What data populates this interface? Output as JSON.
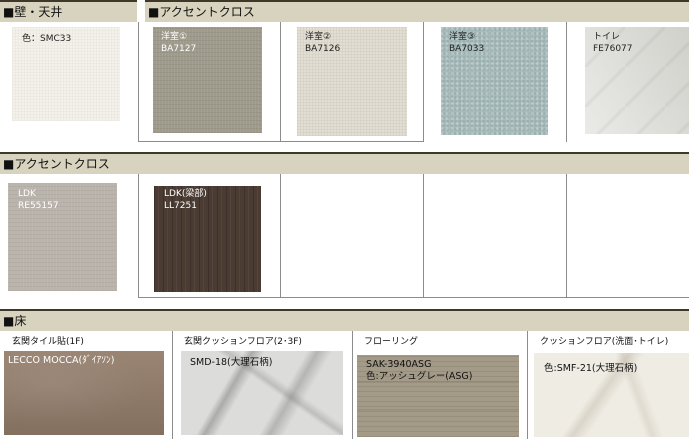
{
  "sections": {
    "wall_ceiling": "■壁・天井",
    "accent_cloth_1": "■アクセントクロス",
    "accent_cloth_2": "■アクセントクロス",
    "floor": "■床"
  },
  "wall_ceiling_swatch": {
    "label": "色：SMC33"
  },
  "accent_row1": [
    {
      "room": "洋室①",
      "code": "BA7127"
    },
    {
      "room": "洋室②",
      "code": "BA7126"
    },
    {
      "room": "洋室③",
      "code": "BA7033"
    },
    {
      "room": "トイレ",
      "code": "FE76077"
    }
  ],
  "accent_row2": [
    {
      "room": "LDK",
      "code": "RE55157"
    },
    {
      "room": "LDK(梁部)",
      "code": "LL7251"
    }
  ],
  "floor_items": [
    {
      "caption": "玄関タイル貼(1F)",
      "label": "LECCO MOCCA(ﾀﾞｲｱｿﾝ)"
    },
    {
      "caption": "玄関クッションフロア(2･3F)",
      "label": "SMD-18(大理石柄)"
    },
    {
      "caption": "フローリング",
      "label": "SAK-3940ASG\n色:アッシュグレー(ASG)"
    },
    {
      "caption": "クッションフロア(洗面･トイレ)",
      "label": "色:SMF-21(大理石柄)"
    }
  ]
}
